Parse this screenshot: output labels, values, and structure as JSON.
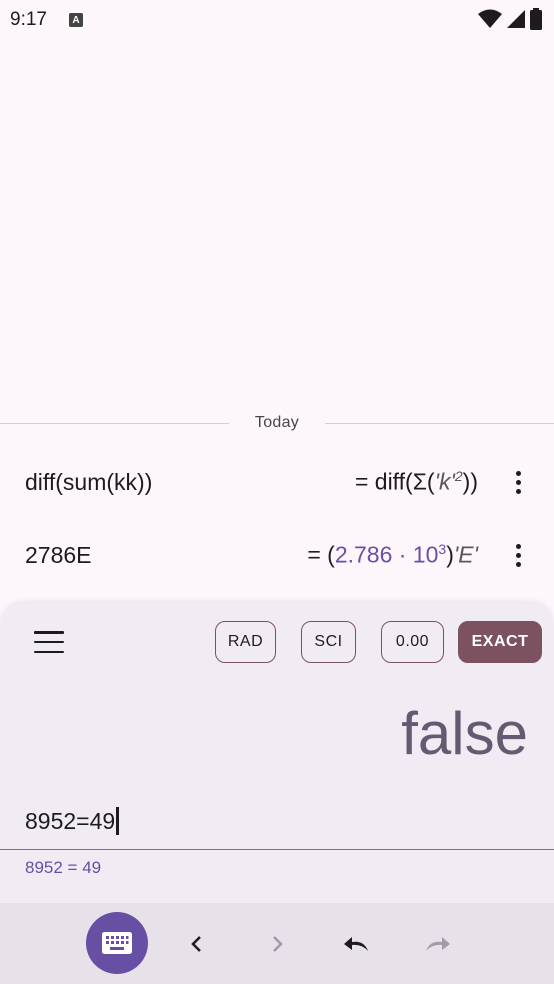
{
  "status": {
    "time": "9:17",
    "a_icon": "A"
  },
  "history": {
    "divider_label": "Today",
    "items": [
      {
        "expression": "diff(sum(kk))",
        "result_prefix": "= diff(Σ(",
        "result_var": "'k'",
        "result_exp": "2",
        "result_suffix": "))"
      },
      {
        "expression": "2786E",
        "result_prefix": "= (",
        "result_mantissa": "2.786 · 10",
        "result_exp": "3",
        "result_close": ")",
        "result_var": "'E'"
      }
    ]
  },
  "panel": {
    "chips": [
      "RAD",
      "SCI",
      "0.00",
      "EXACT"
    ],
    "result": "false",
    "input": "8952=49",
    "preview": "8952 = 49"
  },
  "colors": {
    "accent": "#6750a4",
    "chip_active": "#7d5260"
  }
}
